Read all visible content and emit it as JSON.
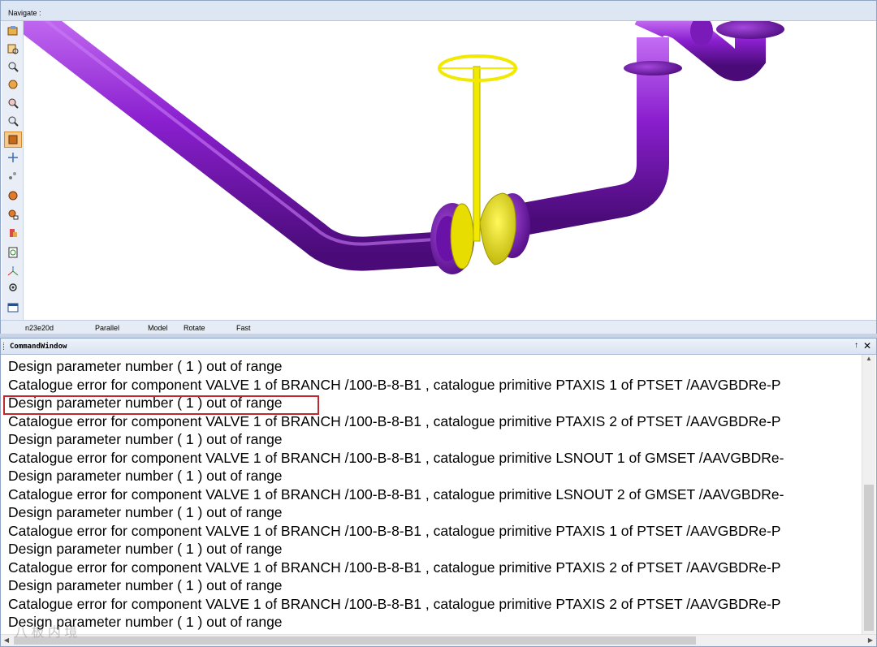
{
  "navigate": {
    "title": "Navigate :",
    "toolbar_icons": [
      "walk-icon",
      "zoom-window-icon",
      "zoom-fit-icon",
      "view-cube-icon",
      "zoom-icon",
      "zoom-in-icon",
      "orbit-icon",
      "pan-icon",
      "fly-icon",
      "model-view-icon",
      "clip-icon",
      "limits-icon",
      "refresh-icon",
      "axes-icon",
      "settings-icon",
      "window-icon"
    ],
    "status": {
      "direction": "n23e20d",
      "projection": "Parallel",
      "mode": "Model",
      "action": "Rotate",
      "speed": "Fast"
    },
    "colors": {
      "pipe": "#8a1fcf",
      "valve": "#f1ea00"
    }
  },
  "command_window": {
    "title": "CommandWindow",
    "pin": "↑",
    "close": "✕",
    "lines": [
      "Design parameter number ( 1 ) out of range",
      "Catalogue error for component VALVE 1 of BRANCH /100-B-8-B1 , catalogue primitive PTAXIS 1 of PTSET /AAVGBDRe-P",
      "Design parameter number ( 1 ) out of range",
      "Catalogue error for component VALVE 1 of BRANCH /100-B-8-B1 , catalogue primitive PTAXIS 2 of PTSET /AAVGBDRe-P",
      "Design parameter number ( 1 ) out of range",
      "Catalogue error for component VALVE 1 of BRANCH /100-B-8-B1 , catalogue primitive LSNOUT 1 of GMSET /AAVGBDRe-",
      "Design parameter number ( 1 ) out of range",
      "Catalogue error for component VALVE 1 of BRANCH /100-B-8-B1 , catalogue primitive LSNOUT 2 of GMSET /AAVGBDRe-",
      "Design parameter number ( 1 ) out of range",
      "Catalogue error for component VALVE 1 of BRANCH /100-B-8-B1 , catalogue primitive PTAXIS 1 of PTSET /AAVGBDRe-P",
      "Design parameter number ( 1 ) out of range",
      "Catalogue error for component VALVE 1 of BRANCH /100-B-8-B1 , catalogue primitive PTAXIS 2 of PTSET /AAVGBDRe-P",
      "Design parameter number ( 1 ) out of range",
      "Catalogue error for component VALVE 1 of BRANCH /100-B-8-B1 , catalogue primitive PTAXIS 2 of PTSET /AAVGBDRe-P",
      "Design parameter number ( 1 ) out of range"
    ],
    "highlighted_line": 2,
    "highlight_color": "#c0282d"
  },
  "watermark": "八 板 内 境"
}
